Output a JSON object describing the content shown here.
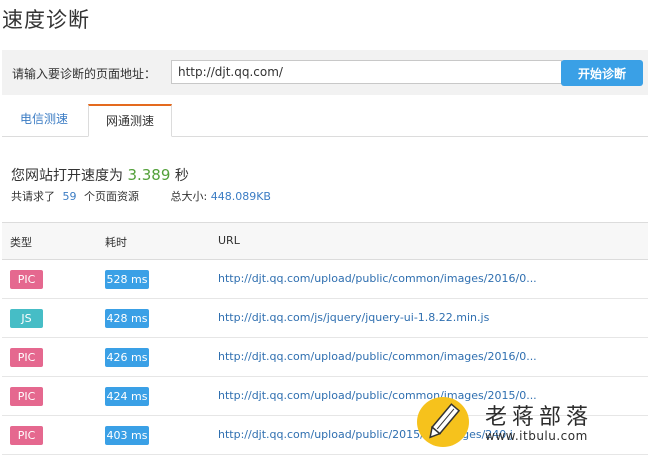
{
  "page_title": "速度诊断",
  "url_bar": {
    "label": "请输入要诊断的页面地址：",
    "url_value": "http://djt.qq.com/",
    "button_label": "开始诊断"
  },
  "tabs": [
    {
      "label": "电信测速",
      "active": false
    },
    {
      "label": "网通测速",
      "active": true
    }
  ],
  "summary": {
    "prefix": "您网站打开速度为",
    "speed": "3.389",
    "unit": "秒",
    "req_prefix": "共请求了",
    "req_count": "59",
    "req_suffix": "个页面资源",
    "size_label": "总大小:",
    "size_value": "448.089KB"
  },
  "table": {
    "headers": [
      "类型",
      "耗时",
      "URL"
    ],
    "rows": [
      {
        "type": "PIC",
        "time": "528 ms",
        "url": "http://djt.qq.com/upload/public/common/images/2016/0..."
      },
      {
        "type": "JS",
        "time": "428 ms",
        "url": "http://djt.qq.com/js/jquery/jquery-ui-1.8.22.min.js"
      },
      {
        "type": "PIC",
        "time": "426 ms",
        "url": "http://djt.qq.com/upload/public/common/images/2016/0..."
      },
      {
        "type": "PIC",
        "time": "424 ms",
        "url": "http://djt.qq.com/upload/public/common/images/2015/0..."
      },
      {
        "type": "PIC",
        "time": "403 ms",
        "url": "http://djt.qq.com/upload/public/2015/05/images/240.j"
      }
    ]
  },
  "colors": {
    "pic_badge": "#e5688f",
    "js_badge": "#46bdc6",
    "time_badge": "#3aa0e6",
    "accent_tab": "#e46a1e",
    "speed_green": "#53a03a"
  },
  "watermark": {
    "title": "老蒋部落",
    "url": "www.itbulu.com",
    "icon": "pencil-icon"
  }
}
